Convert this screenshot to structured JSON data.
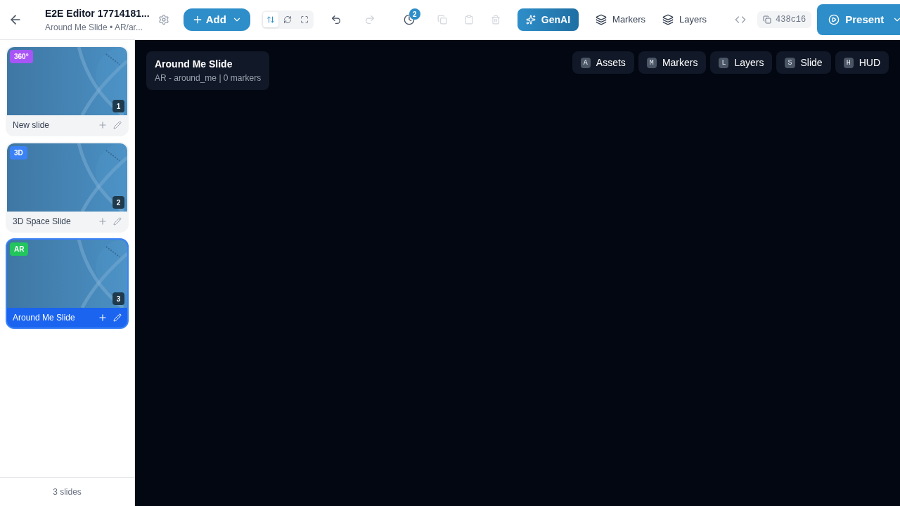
{
  "header": {
    "title": "E2E Editor 17714181...",
    "subtitle": "Around Me Slide • AR/ar...",
    "add_label": "Add",
    "history_count": "2",
    "genai_label": "GenAI",
    "markers_label": "Markers",
    "layers_label": "Layers",
    "commit": "438c16",
    "present_label": "Present"
  },
  "view_toggles": [
    {
      "selected": true
    },
    {
      "selected": false
    },
    {
      "selected": false
    }
  ],
  "slides": [
    {
      "badge": "360°",
      "color": "#a855f7",
      "number": "1",
      "name": "New slide",
      "selected": false
    },
    {
      "badge": "3D",
      "color": "#3b82f6",
      "number": "2",
      "name": "3D Space Slide",
      "selected": false
    },
    {
      "badge": "AR",
      "color": "#22c55e",
      "number": "3",
      "name": "Around Me Slide",
      "selected": true
    }
  ],
  "slide_count": "3 slides",
  "info": {
    "title": "Around Me Slide",
    "subtitle": "AR - around_me | 0 markers"
  },
  "panel_buttons": [
    {
      "key": "A",
      "label": "Assets"
    },
    {
      "key": "M",
      "label": "Markers"
    },
    {
      "key": "L",
      "label": "Layers"
    },
    {
      "key": "S",
      "label": "Slide"
    },
    {
      "key": "H",
      "label": "HUD"
    }
  ]
}
